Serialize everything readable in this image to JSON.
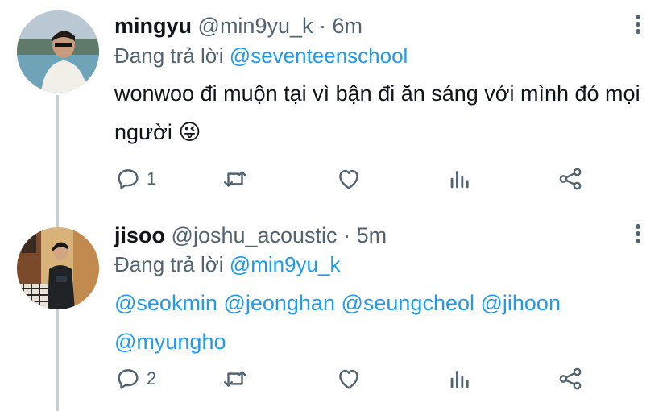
{
  "tweets": [
    {
      "name": "mingyu",
      "handle": "@min9yu_k",
      "dot": "·",
      "time": "6m",
      "replying_prefix": "Đang trả lời",
      "replying_to": "@seventeenschool",
      "text": "wonwoo đi muộn tại vì bận đi ăn sáng với mình đó mọi người 😜",
      "reply_count": "1"
    },
    {
      "name": "jisoo",
      "handle": "@joshu_acoustic",
      "dot": "·",
      "time": "5m",
      "replying_prefix": "Đang trả lời",
      "replying_to": "@min9yu_k",
      "text": "@seokmin @jeonghan @seungcheol @jihoon @myungho",
      "reply_count": "2"
    }
  ],
  "colors": {
    "accent": "#1d9bf0",
    "secondary_text": "#536471",
    "primary_text": "#0f1419",
    "thread_line": "#c4cfd6"
  },
  "icons": [
    "more-vertical-icon",
    "reply-icon",
    "retweet-icon",
    "like-icon",
    "analytics-icon",
    "share-icon"
  ]
}
